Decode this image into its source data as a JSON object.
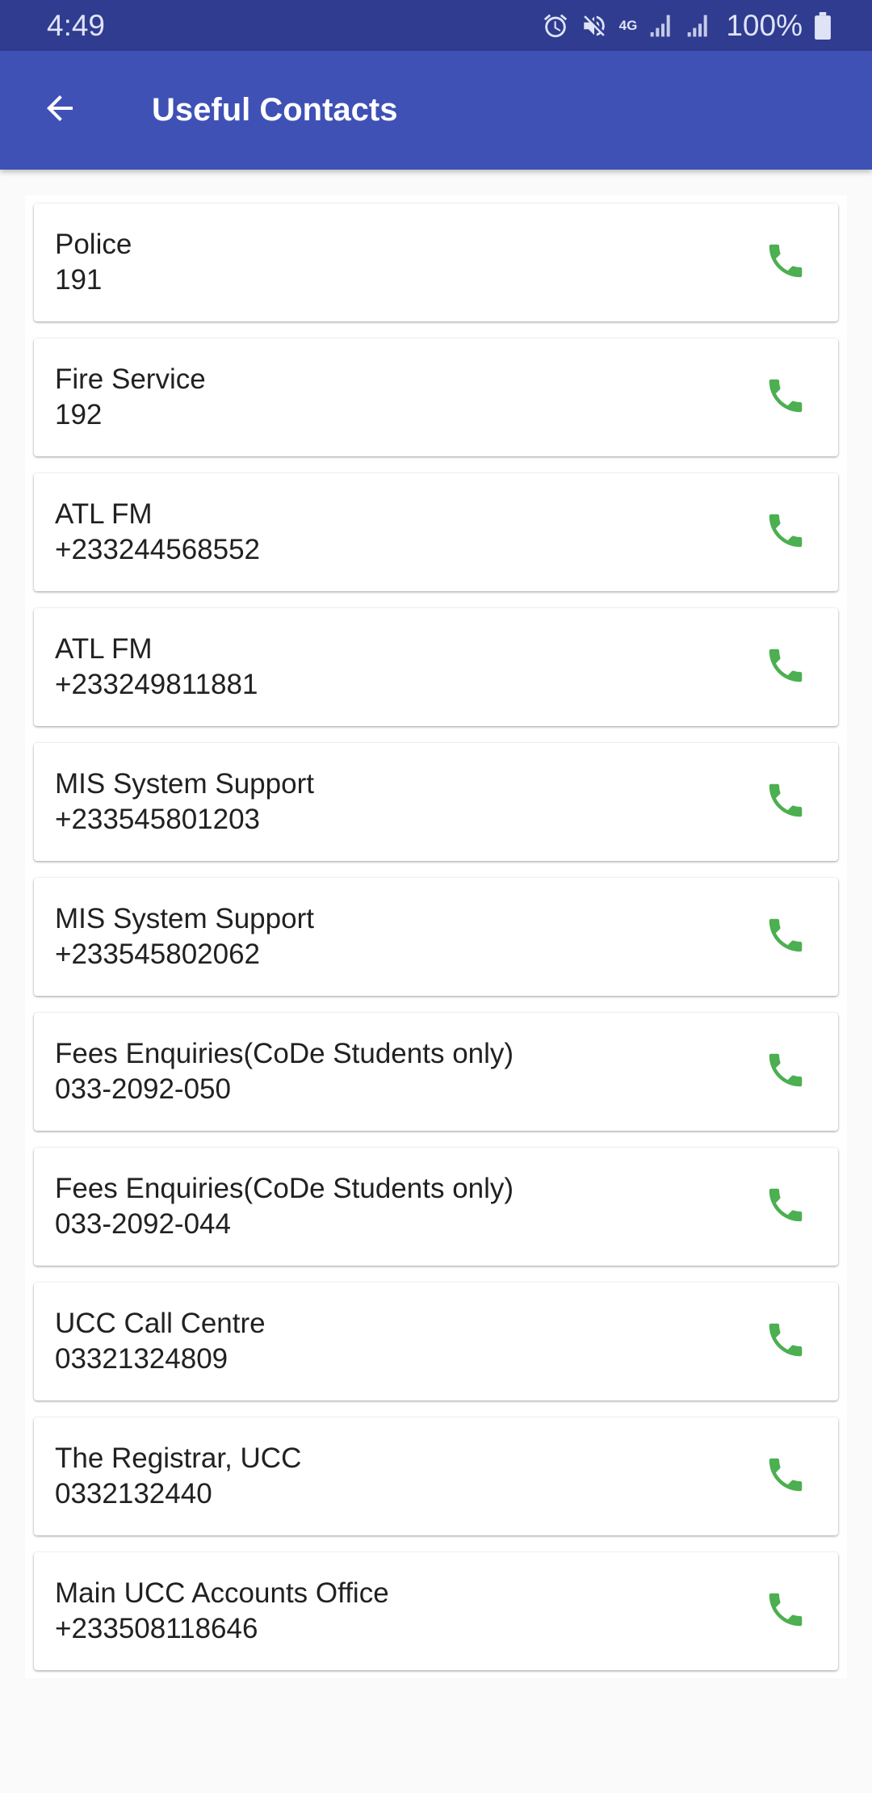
{
  "status_bar": {
    "time": "4:49",
    "network": "4G",
    "battery": "100%"
  },
  "app_bar": {
    "title": "Useful Contacts"
  },
  "contacts": [
    {
      "name": "Police",
      "number": "191"
    },
    {
      "name": "Fire Service",
      "number": "192"
    },
    {
      "name": "ATL FM",
      "number": "+233244568552"
    },
    {
      "name": "ATL FM",
      "number": "+233249811881"
    },
    {
      "name": "MIS System Support",
      "number": "+233545801203"
    },
    {
      "name": "MIS System Support",
      "number": "+233545802062"
    },
    {
      "name": "Fees Enquiries(CoDe Students only)",
      "number": "033-2092-050"
    },
    {
      "name": "Fees Enquiries(CoDe Students only)",
      "number": "033-2092-044"
    },
    {
      "name": "UCC Call Centre",
      "number": "03321324809"
    },
    {
      "name": "The Registrar, UCC",
      "number": "0332132440"
    },
    {
      "name": "Main UCC Accounts Office",
      "number": "+233508118646"
    }
  ],
  "icons": {
    "back": "arrow-back-icon",
    "call": "phone-icon"
  },
  "colors": {
    "status_bar": "#2f3c8f",
    "app_bar": "#3f51b5",
    "call_icon": "#4caf50"
  }
}
